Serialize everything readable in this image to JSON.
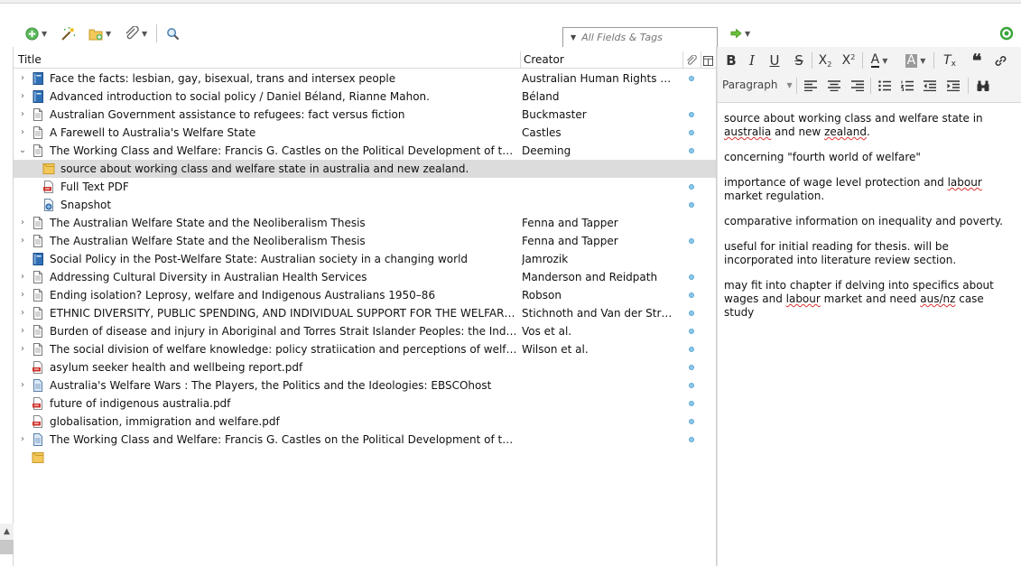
{
  "search": {
    "placeholder": "All Fields & Tags"
  },
  "columns": {
    "title": "Title",
    "creator": "Creator"
  },
  "items": [
    {
      "twisty": "›",
      "icon": "book",
      "title": "Face the facts: lesbian, gay, bisexual, trans and intersex people",
      "creator": "Australian Human Rights Com…",
      "attachment": true,
      "level": 0
    },
    {
      "twisty": "›",
      "icon": "book",
      "title": "Advanced introduction to social policy / Daniel Béland, Rianne Mahon.",
      "creator": "Béland",
      "attachment": false,
      "level": 0
    },
    {
      "twisty": "›",
      "icon": "document",
      "title": "Australian Government assistance to refugees: fact versus fiction",
      "creator": "Buckmaster",
      "attachment": true,
      "level": 0
    },
    {
      "twisty": "›",
      "icon": "document",
      "title": "A Farewell to Australia's Welfare State",
      "creator": "Castles",
      "attachment": true,
      "level": 0
    },
    {
      "twisty": "⌄",
      "icon": "document",
      "title": "The Working Class and Welfare: Francis G. Castles on the Political Development of the Welfare St…",
      "creator": "Deeming",
      "attachment": true,
      "level": 0
    },
    {
      "twisty": "",
      "icon": "note",
      "title": "source about working class and welfare state in australia and new zealand.",
      "creator": "",
      "attachment": false,
      "level": 1,
      "selected": true
    },
    {
      "twisty": "",
      "icon": "pdf",
      "title": "Full Text PDF",
      "creator": "",
      "attachment": true,
      "level": 1
    },
    {
      "twisty": "",
      "icon": "snapshot",
      "title": "Snapshot",
      "creator": "",
      "attachment": true,
      "level": 1
    },
    {
      "twisty": "›",
      "icon": "document",
      "title": "The Australian Welfare State and the Neoliberalism Thesis",
      "creator": "Fenna and Tapper",
      "attachment": false,
      "level": 0
    },
    {
      "twisty": "›",
      "icon": "document",
      "title": "The Australian Welfare State and the Neoliberalism Thesis",
      "creator": "Fenna and Tapper",
      "attachment": true,
      "level": 0
    },
    {
      "twisty": "",
      "icon": "book",
      "title": "Social Policy in the Post-Welfare State: Australian society in a changing world",
      "creator": "Jamrozik",
      "attachment": false,
      "level": 0
    },
    {
      "twisty": "›",
      "icon": "document",
      "title": "Addressing Cultural Diversity in Australian Health Services",
      "creator": "Manderson and Reidpath",
      "attachment": true,
      "level": 0
    },
    {
      "twisty": "›",
      "icon": "document",
      "title": "Ending isolation? Leprosy, welfare and Indigenous Australians 1950–86",
      "creator": "Robson",
      "attachment": true,
      "level": 0
    },
    {
      "twisty": "›",
      "icon": "document",
      "title": "ETHNIC DIVERSITY, PUBLIC SPENDING, AND INDIVIDUAL SUPPORT FOR THE WELFARE STATE: A …",
      "creator": "Stichnoth and Van der Straeten",
      "attachment": true,
      "level": 0
    },
    {
      "twisty": "›",
      "icon": "document",
      "title": "Burden of disease and injury in Aboriginal and Torres Strait Islander Peoples: the Indigenous healt…",
      "creator": "Vos et al.",
      "attachment": true,
      "level": 0
    },
    {
      "twisty": "›",
      "icon": "document",
      "title": "The social division of welfare knowledge: policy stratiication and perceptions of welfare reform in…",
      "creator": "Wilson et al.",
      "attachment": true,
      "level": 0
    },
    {
      "twisty": "",
      "icon": "pdf",
      "title": "asylum seeker health and wellbeing report.pdf",
      "creator": "",
      "attachment": true,
      "level": 0
    },
    {
      "twisty": "›",
      "icon": "webpage",
      "title": "Australia's Welfare Wars : The Players, the Politics and the Ideologies: EBSCOhost",
      "creator": "",
      "attachment": true,
      "level": 0
    },
    {
      "twisty": "",
      "icon": "pdf",
      "title": "future of indigenous australia.pdf",
      "creator": "",
      "attachment": true,
      "level": 0
    },
    {
      "twisty": "",
      "icon": "pdf",
      "title": "globalisation, immigration and welfare.pdf",
      "creator": "",
      "attachment": true,
      "level": 0
    },
    {
      "twisty": "›",
      "icon": "webpage",
      "title": "The Working Class and Welfare: Francis G. Castles on the Political Development of the Welfare St…",
      "creator": "",
      "attachment": true,
      "level": 0
    },
    {
      "twisty": "",
      "icon": "note",
      "title": "",
      "creator": "",
      "attachment": false,
      "level": 0
    }
  ],
  "note_editor": {
    "paragraph_format": "Paragraph",
    "paragraphs": [
      "source about working class and welfare state in australia and new zealand.",
      "concerning \"fourth world of welfare\"",
      "importance of wage level protection and labour market regulation.",
      "comparative information on inequality and poverty.",
      "useful for initial reading for thesis. will be incorporated into literature review section.",
      "may fit into chapter if delving into specifics about wages and labour market and need aus/nz case study"
    ]
  },
  "colors": {
    "selected_row": "#dcdcdc",
    "attachment_dot": "#8fc7e8",
    "book_icon": "#2f6fb5",
    "pdf_icon": "#d0342c",
    "note_icon": "#f2c85a",
    "sync_icon": "#3aa53a"
  }
}
